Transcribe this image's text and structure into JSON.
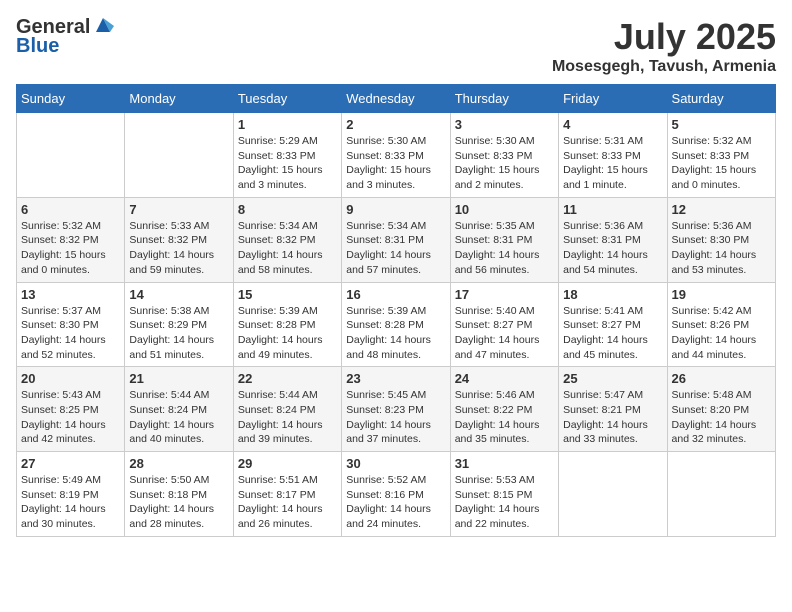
{
  "header": {
    "logo_general": "General",
    "logo_blue": "Blue",
    "month": "July 2025",
    "location": "Mosesgegh, Tavush, Armenia"
  },
  "weekdays": [
    "Sunday",
    "Monday",
    "Tuesday",
    "Wednesday",
    "Thursday",
    "Friday",
    "Saturday"
  ],
  "weeks": [
    [
      {
        "day": "",
        "info": ""
      },
      {
        "day": "",
        "info": ""
      },
      {
        "day": "1",
        "info": "Sunrise: 5:29 AM\nSunset: 8:33 PM\nDaylight: 15 hours and 3 minutes."
      },
      {
        "day": "2",
        "info": "Sunrise: 5:30 AM\nSunset: 8:33 PM\nDaylight: 15 hours and 3 minutes."
      },
      {
        "day": "3",
        "info": "Sunrise: 5:30 AM\nSunset: 8:33 PM\nDaylight: 15 hours and 2 minutes."
      },
      {
        "day": "4",
        "info": "Sunrise: 5:31 AM\nSunset: 8:33 PM\nDaylight: 15 hours and 1 minute."
      },
      {
        "day": "5",
        "info": "Sunrise: 5:32 AM\nSunset: 8:33 PM\nDaylight: 15 hours and 0 minutes."
      }
    ],
    [
      {
        "day": "6",
        "info": "Sunrise: 5:32 AM\nSunset: 8:32 PM\nDaylight: 15 hours and 0 minutes."
      },
      {
        "day": "7",
        "info": "Sunrise: 5:33 AM\nSunset: 8:32 PM\nDaylight: 14 hours and 59 minutes."
      },
      {
        "day": "8",
        "info": "Sunrise: 5:34 AM\nSunset: 8:32 PM\nDaylight: 14 hours and 58 minutes."
      },
      {
        "day": "9",
        "info": "Sunrise: 5:34 AM\nSunset: 8:31 PM\nDaylight: 14 hours and 57 minutes."
      },
      {
        "day": "10",
        "info": "Sunrise: 5:35 AM\nSunset: 8:31 PM\nDaylight: 14 hours and 56 minutes."
      },
      {
        "day": "11",
        "info": "Sunrise: 5:36 AM\nSunset: 8:31 PM\nDaylight: 14 hours and 54 minutes."
      },
      {
        "day": "12",
        "info": "Sunrise: 5:36 AM\nSunset: 8:30 PM\nDaylight: 14 hours and 53 minutes."
      }
    ],
    [
      {
        "day": "13",
        "info": "Sunrise: 5:37 AM\nSunset: 8:30 PM\nDaylight: 14 hours and 52 minutes."
      },
      {
        "day": "14",
        "info": "Sunrise: 5:38 AM\nSunset: 8:29 PM\nDaylight: 14 hours and 51 minutes."
      },
      {
        "day": "15",
        "info": "Sunrise: 5:39 AM\nSunset: 8:28 PM\nDaylight: 14 hours and 49 minutes."
      },
      {
        "day": "16",
        "info": "Sunrise: 5:39 AM\nSunset: 8:28 PM\nDaylight: 14 hours and 48 minutes."
      },
      {
        "day": "17",
        "info": "Sunrise: 5:40 AM\nSunset: 8:27 PM\nDaylight: 14 hours and 47 minutes."
      },
      {
        "day": "18",
        "info": "Sunrise: 5:41 AM\nSunset: 8:27 PM\nDaylight: 14 hours and 45 minutes."
      },
      {
        "day": "19",
        "info": "Sunrise: 5:42 AM\nSunset: 8:26 PM\nDaylight: 14 hours and 44 minutes."
      }
    ],
    [
      {
        "day": "20",
        "info": "Sunrise: 5:43 AM\nSunset: 8:25 PM\nDaylight: 14 hours and 42 minutes."
      },
      {
        "day": "21",
        "info": "Sunrise: 5:44 AM\nSunset: 8:24 PM\nDaylight: 14 hours and 40 minutes."
      },
      {
        "day": "22",
        "info": "Sunrise: 5:44 AM\nSunset: 8:24 PM\nDaylight: 14 hours and 39 minutes."
      },
      {
        "day": "23",
        "info": "Sunrise: 5:45 AM\nSunset: 8:23 PM\nDaylight: 14 hours and 37 minutes."
      },
      {
        "day": "24",
        "info": "Sunrise: 5:46 AM\nSunset: 8:22 PM\nDaylight: 14 hours and 35 minutes."
      },
      {
        "day": "25",
        "info": "Sunrise: 5:47 AM\nSunset: 8:21 PM\nDaylight: 14 hours and 33 minutes."
      },
      {
        "day": "26",
        "info": "Sunrise: 5:48 AM\nSunset: 8:20 PM\nDaylight: 14 hours and 32 minutes."
      }
    ],
    [
      {
        "day": "27",
        "info": "Sunrise: 5:49 AM\nSunset: 8:19 PM\nDaylight: 14 hours and 30 minutes."
      },
      {
        "day": "28",
        "info": "Sunrise: 5:50 AM\nSunset: 8:18 PM\nDaylight: 14 hours and 28 minutes."
      },
      {
        "day": "29",
        "info": "Sunrise: 5:51 AM\nSunset: 8:17 PM\nDaylight: 14 hours and 26 minutes."
      },
      {
        "day": "30",
        "info": "Sunrise: 5:52 AM\nSunset: 8:16 PM\nDaylight: 14 hours and 24 minutes."
      },
      {
        "day": "31",
        "info": "Sunrise: 5:53 AM\nSunset: 8:15 PM\nDaylight: 14 hours and 22 minutes."
      },
      {
        "day": "",
        "info": ""
      },
      {
        "day": "",
        "info": ""
      }
    ]
  ]
}
